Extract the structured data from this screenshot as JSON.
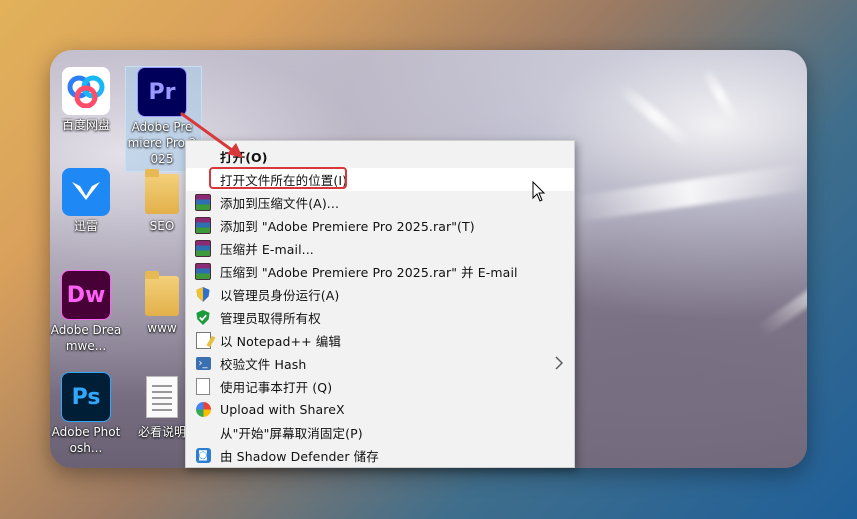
{
  "desktop": {
    "icons": [
      {
        "id": "baidu",
        "label": "百度网盘",
        "glyph": "",
        "bg": "#ffffff",
        "fg": "#2f7df6"
      },
      {
        "id": "premiere",
        "label": "Adobe Premiere Pro 2025",
        "glyph": "Pr",
        "bg": "#00005b",
        "fg": "#9999ff"
      },
      {
        "id": "xunlei",
        "label": "迅雷",
        "glyph": "",
        "bg": "#1e88f5",
        "fg": "#ffffff"
      },
      {
        "id": "seo",
        "label": "SEO",
        "glyph": "",
        "bg": "",
        "fg": ""
      },
      {
        "id": "dreamweaver",
        "label": "Adobe Dreamwe...",
        "glyph": "Dw",
        "bg": "#470137",
        "fg": "#ff61f6"
      },
      {
        "id": "www",
        "label": "www",
        "glyph": "",
        "bg": "",
        "fg": ""
      },
      {
        "id": "photoshop",
        "label": "Adobe Photosh...",
        "glyph": "Ps",
        "bg": "#001e36",
        "fg": "#31a8ff"
      },
      {
        "id": "readme",
        "label": "必看说明",
        "glyph": "",
        "bg": "",
        "fg": ""
      }
    ]
  },
  "context_menu": {
    "items": [
      {
        "label": "打开(O)",
        "icon": "none",
        "bold": true
      },
      {
        "label": "打开文件所在的位置(I)",
        "icon": "none",
        "highlighted": true
      },
      {
        "label": "添加到压缩文件(A)...",
        "icon": "winrar-icon"
      },
      {
        "label": "添加到 \"Adobe Premiere Pro 2025.rar\"(T)",
        "icon": "winrar-icon"
      },
      {
        "label": "压缩并 E-mail...",
        "icon": "winrar-icon"
      },
      {
        "label": "压缩到 \"Adobe Premiere Pro 2025.rar\" 并 E-mail",
        "icon": "winrar-icon"
      },
      {
        "label": "以管理员身份运行(A)",
        "icon": "uac-shield-icon"
      },
      {
        "label": "管理员取得所有权",
        "icon": "green-shield-icon"
      },
      {
        "label": "以 Notepad++ 编辑",
        "icon": "notepadpp-icon"
      },
      {
        "label": "校验文件 Hash",
        "icon": "hash-icon",
        "submenu": true
      },
      {
        "label": "使用记事本打开 (Q)",
        "icon": "notepad-icon"
      },
      {
        "label": "Upload with ShareX",
        "icon": "sharex-icon"
      },
      {
        "label": "从\"开始\"屏幕取消固定(P)",
        "icon": "none"
      },
      {
        "label": "由 Shadow Defender 储存",
        "icon": "shadow-defender-icon"
      }
    ]
  },
  "colors": {
    "annotation_red": "#d8383a",
    "menu_bg": "#f2f2f2"
  }
}
